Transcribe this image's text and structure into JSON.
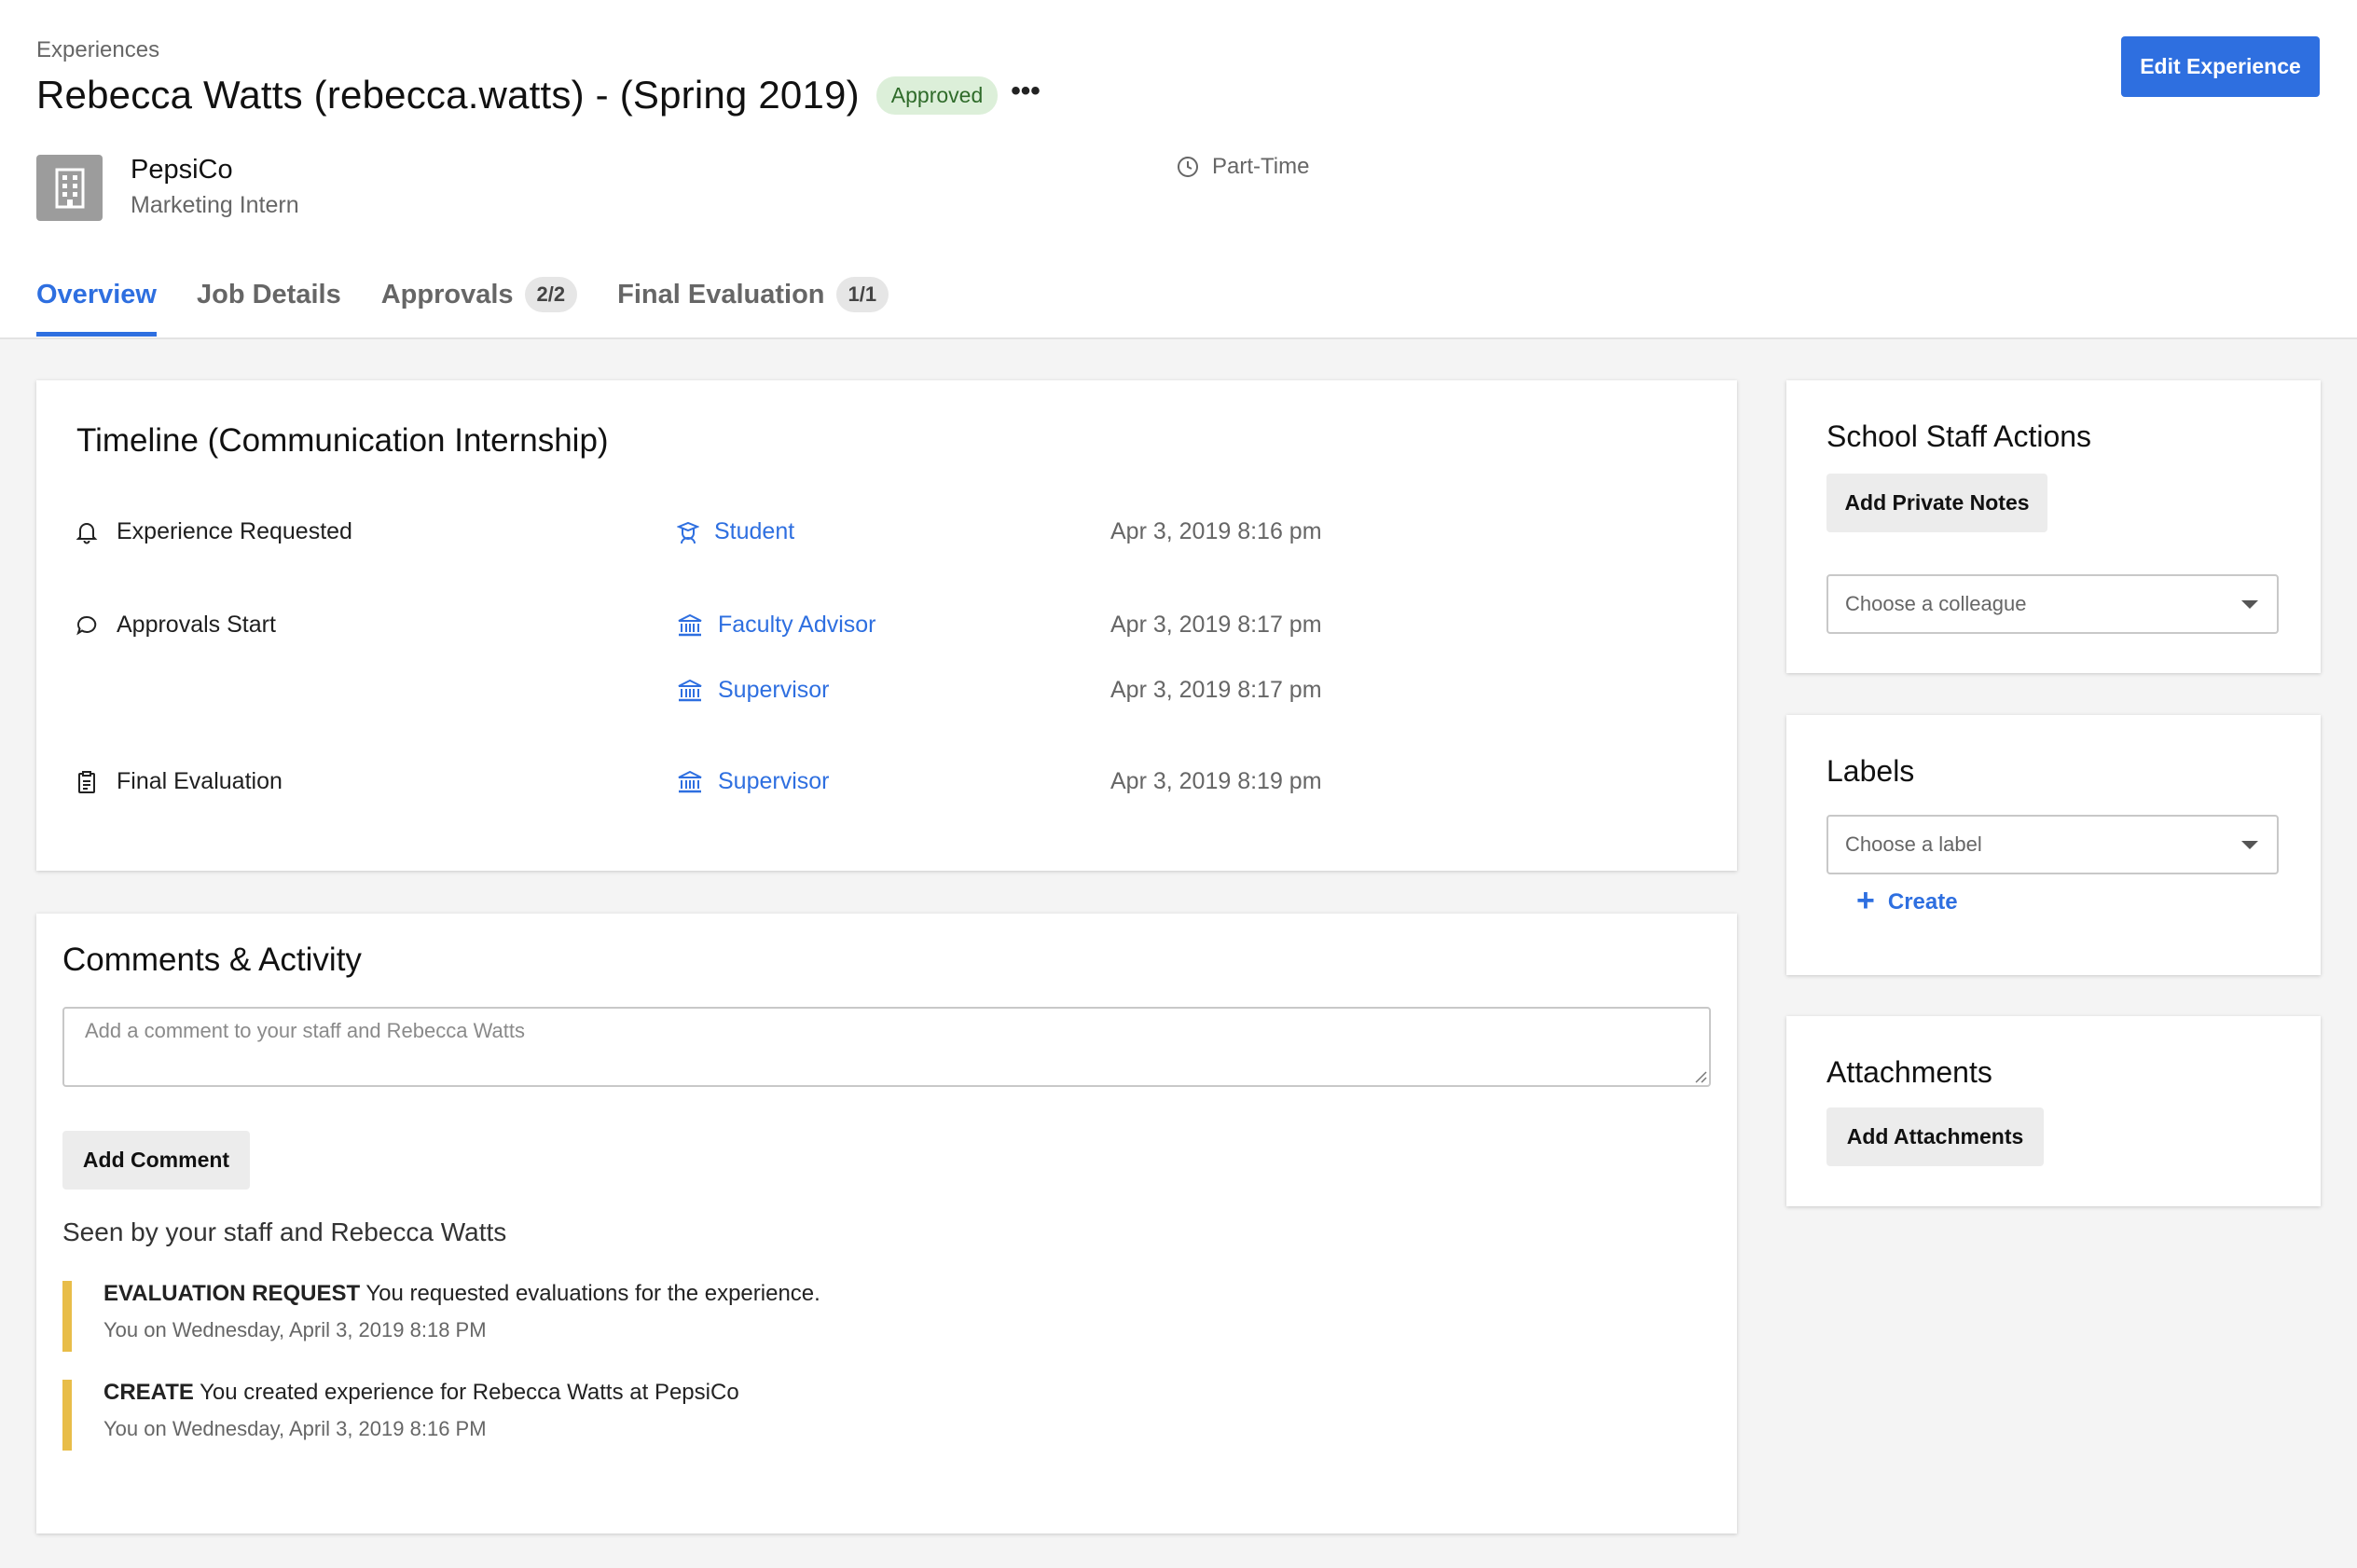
{
  "header": {
    "breadcrumb": "Experiences",
    "title": "Rebecca Watts (rebecca.watts) - (Spring 2019)",
    "status_badge": "Approved",
    "more_icon": "ellipsis-icon",
    "edit_button": "Edit Experience"
  },
  "company": {
    "logo_icon": "building-icon",
    "name": "PepsiCo",
    "role": "Marketing Intern",
    "job_type": "Part-Time",
    "job_type_icon": "clock-icon"
  },
  "tabs": [
    {
      "label": "Overview",
      "count": "",
      "active": true
    },
    {
      "label": "Job Details",
      "count": "",
      "active": false
    },
    {
      "label": "Approvals",
      "count": "2/2",
      "active": false
    },
    {
      "label": "Final Evaluation",
      "count": "1/1",
      "active": false
    }
  ],
  "timeline": {
    "title": "Timeline (Communication Internship)",
    "rows": [
      {
        "event": "Experience Requested",
        "event_icon": "bell-icon",
        "role": "Student",
        "role_icon": "student-icon",
        "date": "Apr 3, 2019 8:16 pm"
      },
      {
        "event": "Approvals Start",
        "event_icon": "chat-bubble-icon",
        "role": "Faculty Advisor",
        "role_icon": "institution-icon",
        "date": "Apr 3, 2019 8:17 pm"
      },
      {
        "event": "",
        "event_icon": "",
        "role": "Supervisor",
        "role_icon": "institution-icon",
        "date": "Apr 3, 2019 8:17 pm"
      },
      {
        "event": "Final Evaluation",
        "event_icon": "clipboard-icon",
        "role": "Supervisor",
        "role_icon": "institution-icon",
        "date": "Apr 3, 2019 8:19 pm"
      }
    ]
  },
  "comments": {
    "title": "Comments & Activity",
    "placeholder": "Add a comment to your staff and Rebecca Watts",
    "add_button": "Add Comment",
    "seen_by": "Seen by your staff and Rebecca Watts",
    "activity": [
      {
        "type": "EVALUATION REQUEST",
        "text": "You requested evaluations for the experience.",
        "meta": "You on Wednesday, April 3, 2019 8:18 PM"
      },
      {
        "type": "CREATE",
        "text": "You created experience for Rebecca Watts at PepsiCo",
        "meta": "You on Wednesday, April 3, 2019 8:16 PM"
      }
    ]
  },
  "staff_actions": {
    "title": "School Staff Actions",
    "notes_button": "Add Private Notes",
    "colleague_select": "Choose a colleague"
  },
  "labels": {
    "title": "Labels",
    "label_select": "Choose a label",
    "create_link": "Create"
  },
  "attachments": {
    "title": "Attachments",
    "add_button": "Add Attachments"
  },
  "colors": {
    "accent": "#2e6fe0",
    "approved_bg": "#dcefd9",
    "approved_text": "#2f6b2a",
    "activity_bar": "#e8bd49"
  }
}
